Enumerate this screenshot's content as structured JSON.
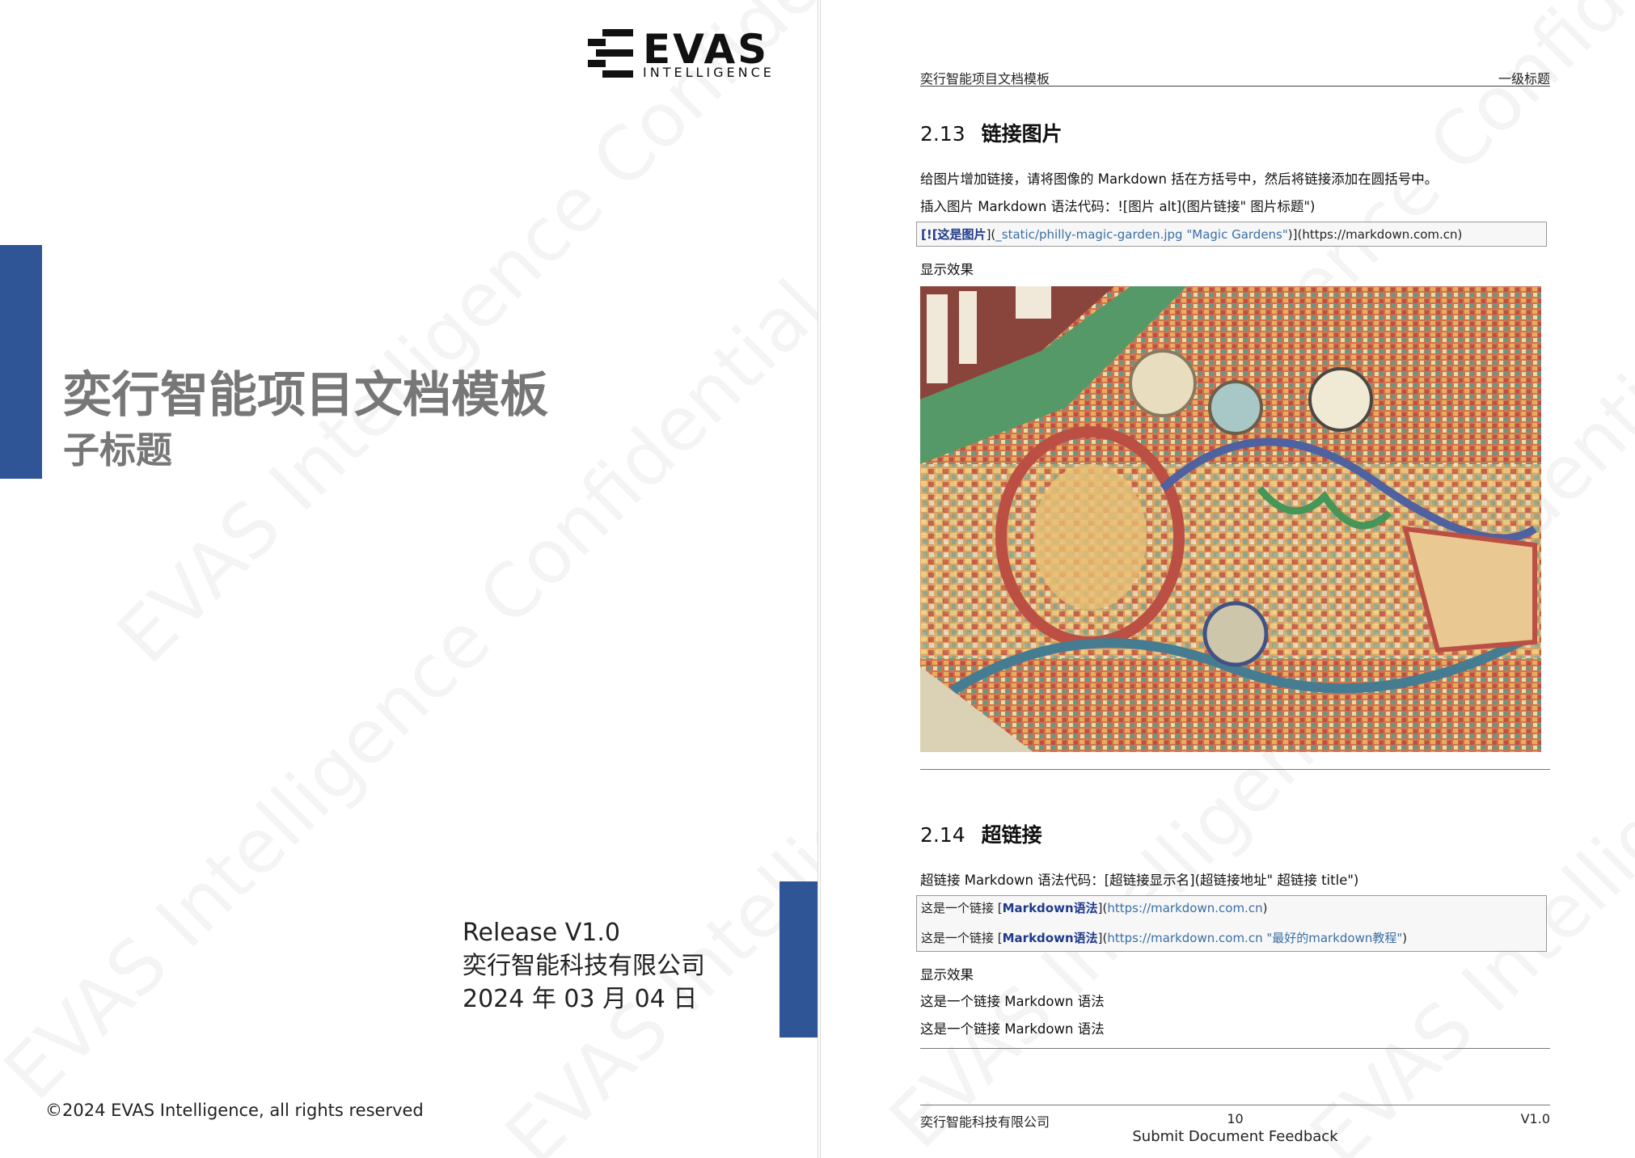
{
  "cover": {
    "logo_word": "EVAS",
    "logo_sub": "INTELLIGENCE",
    "title": "奕行智能项目文档模板",
    "subtitle": "子标题",
    "release": "Release  V1.0",
    "company": "奕行智能科技有限公司",
    "date": "2024 年 03 月 04 日",
    "copyright": "©2024  EVAS Intelligence, all rights reserved",
    "accent_color": "#2f5597"
  },
  "watermarks": {
    "confidential": "EVAS Intelligence Confidential"
  },
  "content": {
    "header_left": "奕行智能项目文档模板",
    "header_right": "一级标题",
    "sec1": {
      "num": "2.13",
      "title": "链接图片"
    },
    "sec1_p1": "给图片增加链接，请将图像的 Markdown 括在方括号中，然后将链接添加在圆括号中。",
    "sec1_p2": "插入图片 Markdown 语法代码：![图片 alt](图片链接\" 图片标题\")",
    "code1": {
      "bold": "[![这是图片",
      "mid": "](",
      "link": "_static/philly-magic-garden.jpg \"Magic Gardens\"",
      "tail": ")](https://markdown.com.cn)"
    },
    "display_label_1": "显示效果",
    "image_name": "mosaic-mural-photo",
    "sec2": {
      "num": "2.14",
      "title": "超链接"
    },
    "sec2_p1": "超链接 Markdown 语法代码：[超链接显示名](超链接地址\" 超链接 title\")",
    "code2": [
      {
        "prefix": "这是一个链接 [",
        "bold": "Markdown语法",
        "mid": "](",
        "link": "https://markdown.com.cn",
        "tail": ")"
      },
      {
        "prefix": "这是一个链接 [",
        "bold": "Markdown语法",
        "mid": "](",
        "link": "https://markdown.com.cn \"最好的markdown教程\"",
        "tail": ")"
      }
    ],
    "display_label_2": "显示效果",
    "result1": "这是一个链接 Markdown 语法",
    "result2": "这是一个链接 Markdown 语法",
    "footer_left": "奕行智能科技有限公司",
    "footer_page": "10",
    "footer_feedback": "Submit Document Feedback",
    "footer_right": "V1.0"
  }
}
